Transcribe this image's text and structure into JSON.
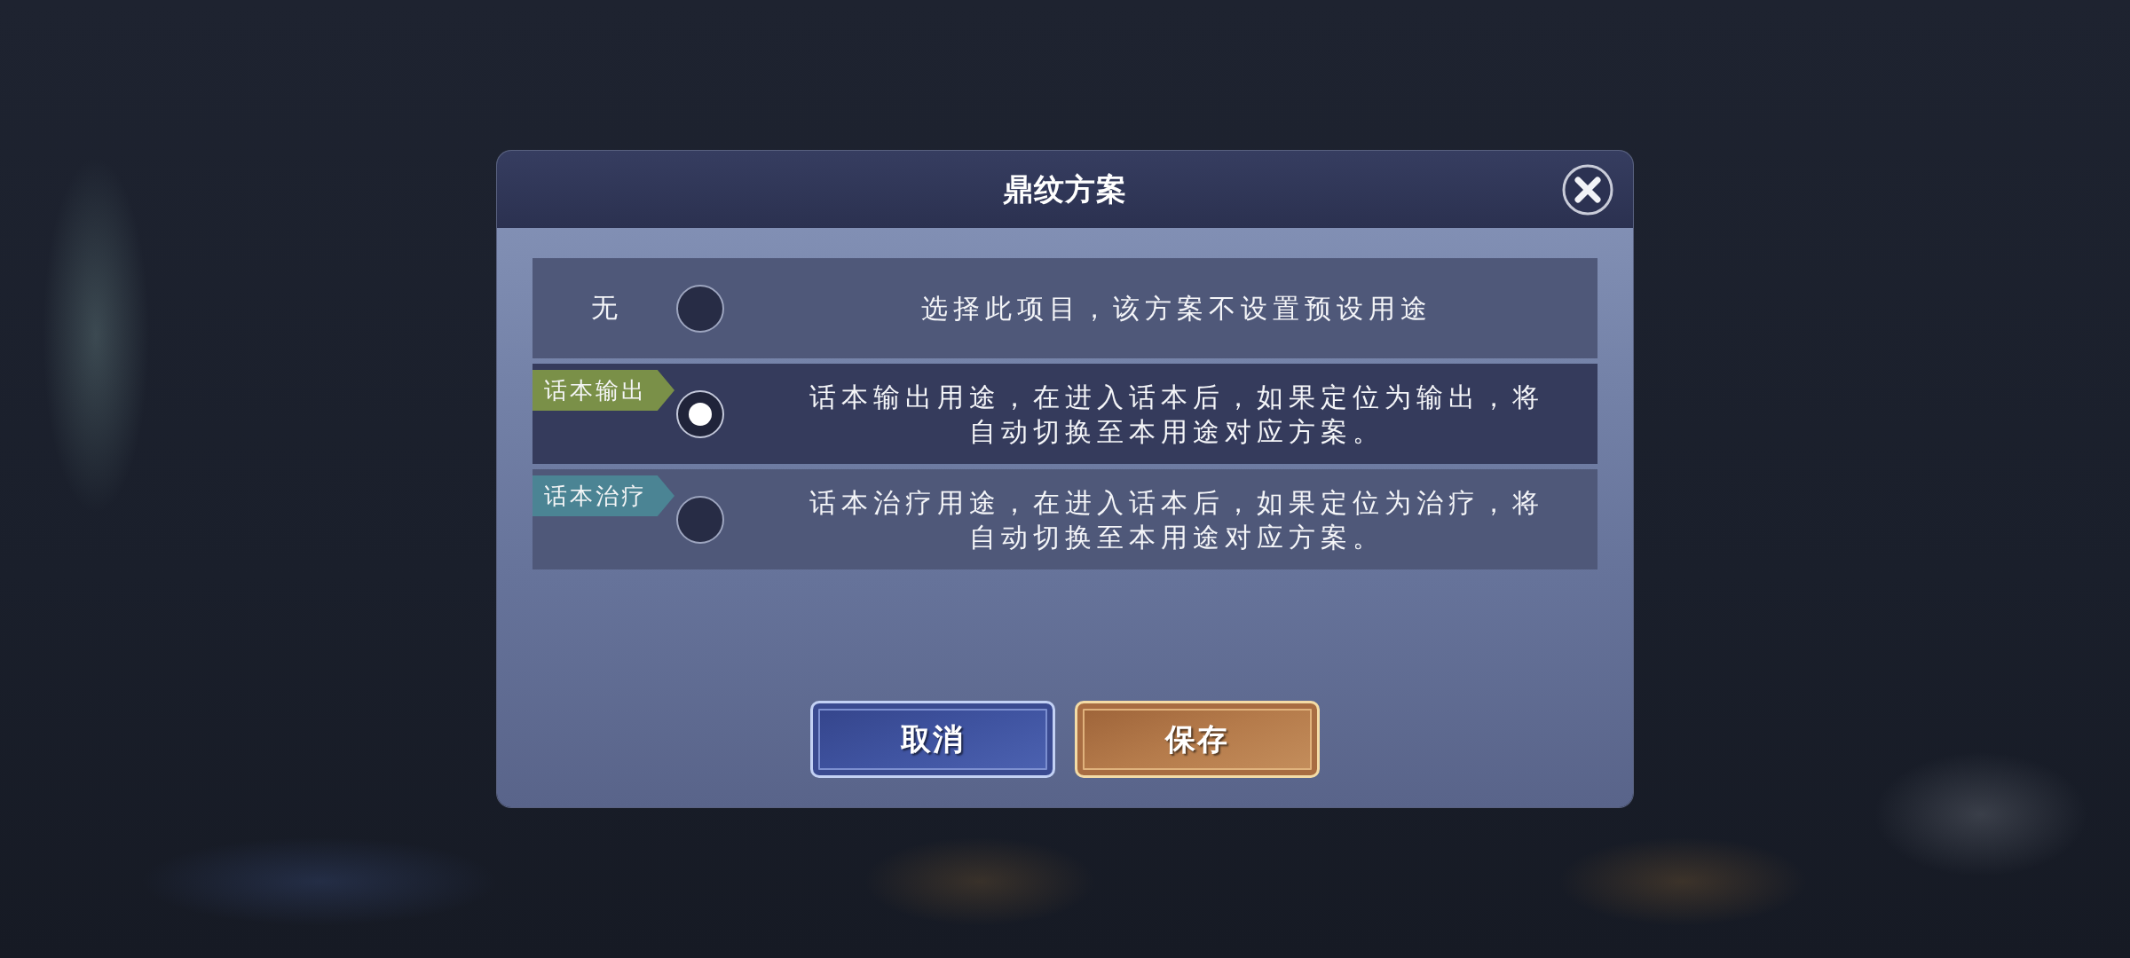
{
  "dialog": {
    "title": "鼎纹方案"
  },
  "options": [
    {
      "kind": "plain",
      "tag": "无",
      "selected": false,
      "description": "选择此项目，该方案不设置预设用途"
    },
    {
      "kind": "ribbon",
      "tag": "话本输出",
      "color": "#7a9048",
      "selected": true,
      "description": "话本输出用途，在进入话本后，如果定位为输出，将自动切换至本用途对应方案。"
    },
    {
      "kind": "ribbon",
      "tag": "话本治疗",
      "color": "#4b8494",
      "selected": false,
      "description": "话本治疗用途，在进入话本后，如果定位为治疗，将自动切换至本用途对应方案。"
    }
  ],
  "buttons": [
    {
      "kind": "cancel",
      "label": "取消"
    },
    {
      "kind": "save",
      "label": "保存"
    }
  ]
}
